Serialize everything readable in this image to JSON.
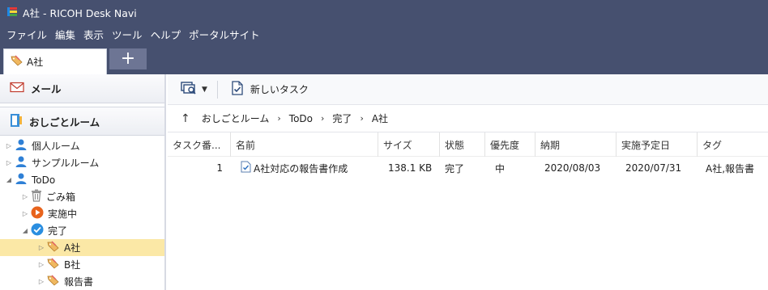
{
  "window": {
    "title": "A社 - RICOH Desk Navi"
  },
  "menu": {
    "items": [
      "ファイル",
      "編集",
      "表示",
      "ツール",
      "ヘルプ",
      "ポータルサイト"
    ]
  },
  "tabs": [
    {
      "label": "A社"
    }
  ],
  "add_tab_label": "+",
  "sidebar": {
    "mail_label": "メール",
    "room_label": "おしごとルーム",
    "tree": [
      {
        "label": "個人ルーム"
      },
      {
        "label": "サンプルルーム"
      },
      {
        "label": "ToDo"
      },
      {
        "label": "ごみ箱"
      },
      {
        "label": "実施中"
      },
      {
        "label": "完了"
      },
      {
        "label": "A社"
      },
      {
        "label": "B社"
      },
      {
        "label": "報告書"
      }
    ]
  },
  "toolbar": {
    "new_task_label": "新しいタスク"
  },
  "breadcrumb": [
    "おしごとルーム",
    "ToDo",
    "完了",
    "A社"
  ],
  "table": {
    "columns": [
      "タスク番...",
      "名前",
      "サイズ",
      "状態",
      "優先度",
      "納期",
      "実施予定日",
      "タグ"
    ],
    "rows": [
      {
        "number": "1",
        "name": "A社対応の報告書作成",
        "size": "138.1 KB",
        "status": "完了",
        "priority": "中",
        "due": "2020/08/03",
        "planned": "2020/07/31",
        "tags": "A社,報告書"
      }
    ]
  }
}
